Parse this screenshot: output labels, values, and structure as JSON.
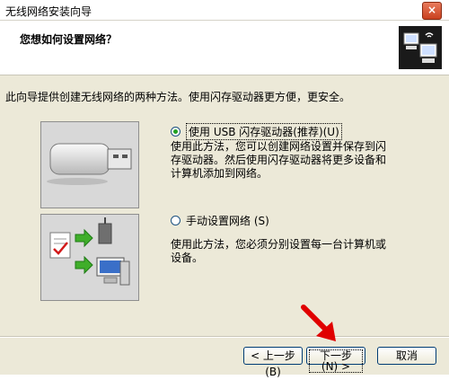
{
  "window": {
    "title": "无线网络安装向导",
    "close_glyph": "×"
  },
  "header": {
    "title": "您想如何设置网络？",
    "icon": "wireless-computers-icon"
  },
  "intro": "此向导提供创建无线网络的两种方法。使用闪存驱动器更方便，更安全。",
  "options": [
    {
      "label": "使用 USB 闪存驱动器(推荐)(U)",
      "selected": true,
      "description": "使用此方法，您可以创建网络设置并保存到闪存驱动器。然后使用闪存驱动器将更多设备和计算机添加到网络。",
      "image": "usb-flash-drive-icon"
    },
    {
      "label": "手动设置网络 (S)",
      "selected": false,
      "description": "使用此方法，您必须分别设置每一台计算机或设备。",
      "image": "manual-network-setup-icon"
    }
  ],
  "buttons": {
    "back": "< 上一步 (B)",
    "next": "下一步 (N) >",
    "cancel": "取消"
  },
  "colors": {
    "arrow": "#e00000",
    "window_bg": "#ece9d8"
  }
}
